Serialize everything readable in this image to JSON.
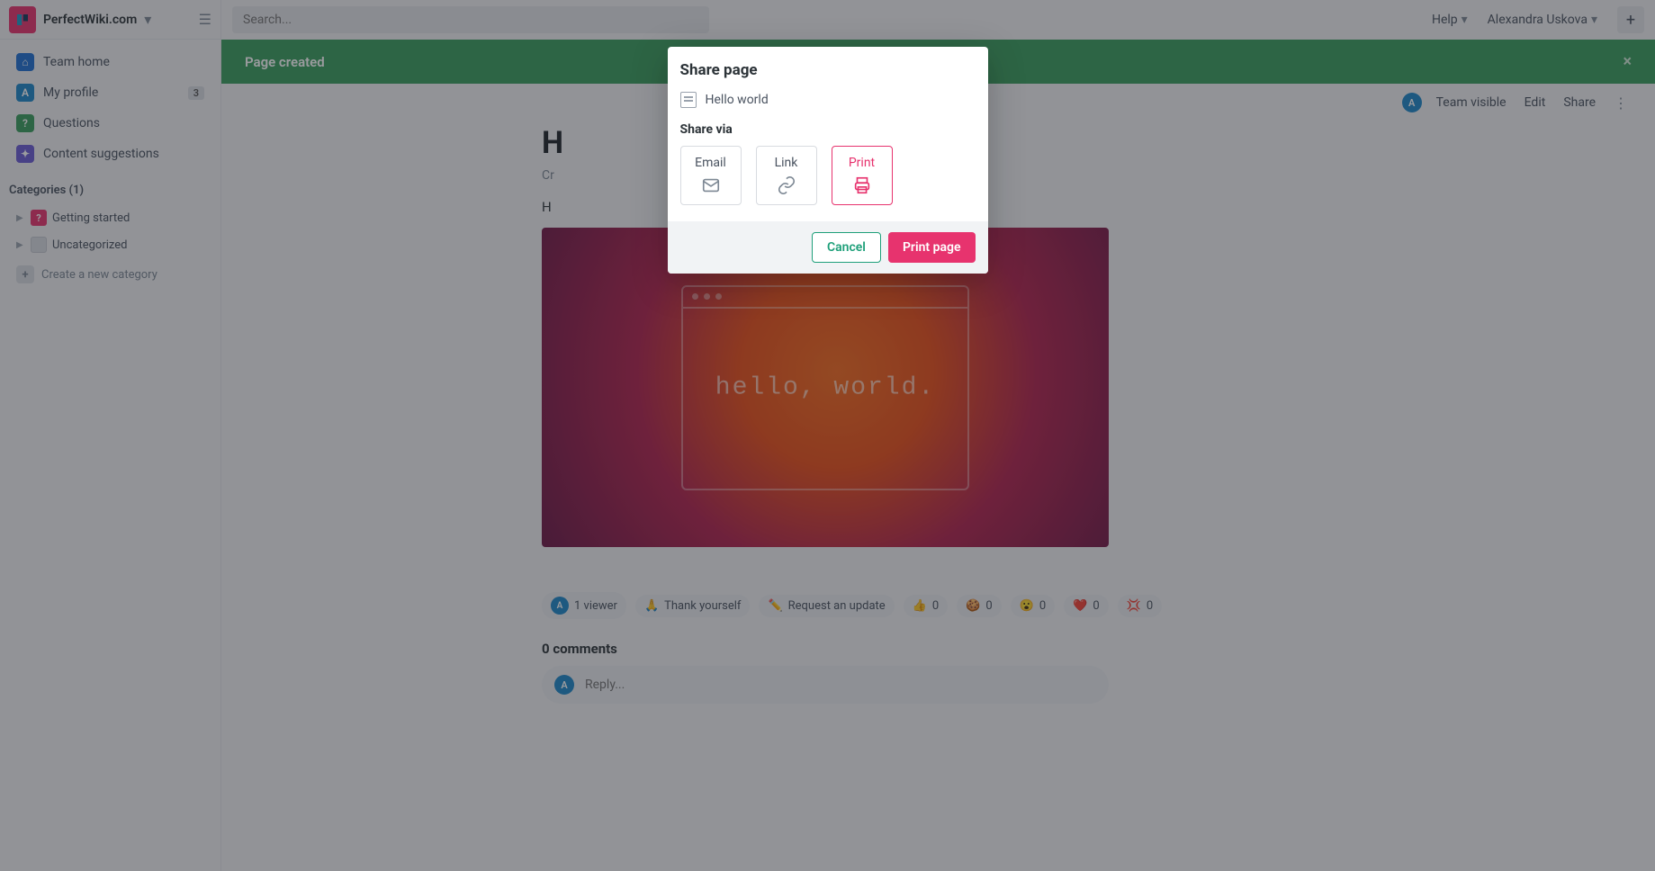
{
  "brand": {
    "name": "PerfectWiki.com"
  },
  "search": {
    "placeholder": "Search..."
  },
  "topbar": {
    "help": "Help",
    "user": "Alexandra Uskova"
  },
  "sidebar": {
    "items": [
      {
        "label": "Team home",
        "icon_bg": "#1f6fd1",
        "glyph": "⌂"
      },
      {
        "label": "My profile",
        "icon_bg": "#1e88c9",
        "glyph": "A",
        "badge": "3"
      },
      {
        "label": "Questions",
        "icon_bg": "#3a9d5d",
        "glyph": "?"
      },
      {
        "label": "Content suggestions",
        "icon_bg": "#6a5bd4",
        "glyph": "✦"
      }
    ],
    "categories_header": "Categories (1)",
    "categories": [
      {
        "label": "Getting started",
        "icon_bg": "#e7336e",
        "glyph": "?"
      },
      {
        "label": "Uncategorized",
        "icon_bg": "#d8dbe0",
        "glyph": ""
      }
    ],
    "create_category": "Create a new category"
  },
  "banner": {
    "text": "Page created"
  },
  "page_toolbar": {
    "avatar_initial": "A",
    "team_visible": "Team visible",
    "edit": "Edit",
    "share": "Share"
  },
  "page": {
    "title_visible_prefix": "H",
    "created_prefix": "Cr",
    "body_visible_prefix": "H",
    "hero_text": "hello, world."
  },
  "footer": {
    "viewer_initial": "A",
    "viewer_text": "1 viewer",
    "thank": "Thank yourself",
    "request": "Request an update",
    "reactions": [
      {
        "emoji": "👍",
        "count": "0"
      },
      {
        "emoji": "🍪",
        "count": "0"
      },
      {
        "emoji": "😮",
        "count": "0"
      },
      {
        "emoji": "❤️",
        "count": "0"
      },
      {
        "emoji": "💢",
        "count": "0"
      }
    ],
    "thank_emoji": "🙏",
    "pencil_emoji": "✏️"
  },
  "comments": {
    "header": "0 comments",
    "reply_placeholder": "Reply...",
    "avatar_initial": "A"
  },
  "modal": {
    "title": "Share page",
    "page_name": "Hello world",
    "share_via_label": "Share via",
    "options": [
      {
        "key": "email",
        "label": "Email"
      },
      {
        "key": "link",
        "label": "Link"
      },
      {
        "key": "print",
        "label": "Print",
        "selected": true
      }
    ],
    "cancel": "Cancel",
    "confirm": "Print page"
  }
}
